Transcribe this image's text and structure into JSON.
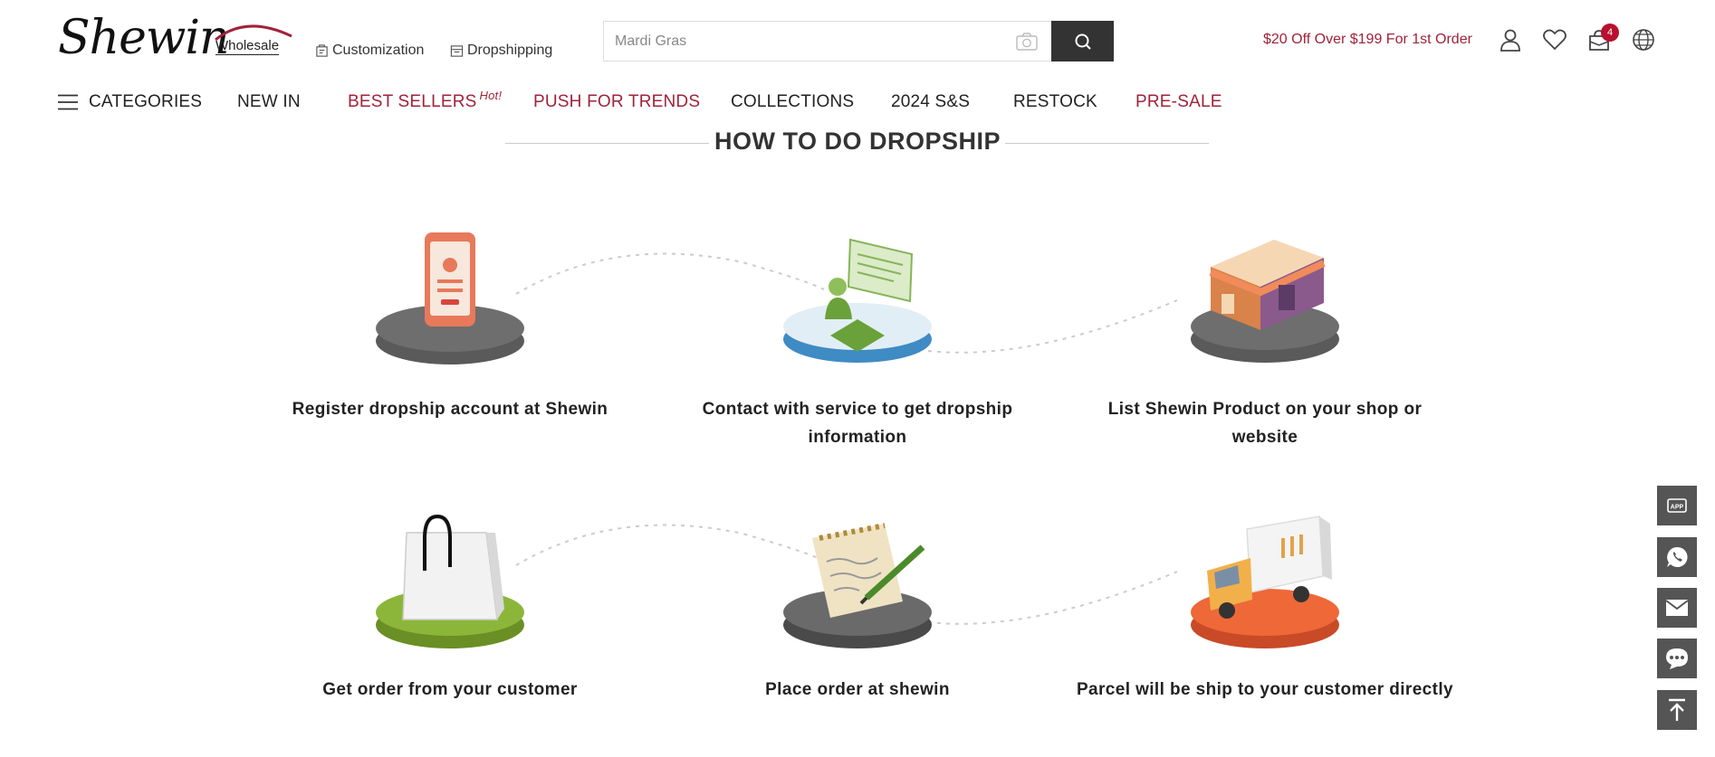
{
  "header": {
    "logo": {
      "brand": "Shewin",
      "sub": "Wholesale"
    },
    "links": {
      "customization": "Customization",
      "dropshipping": "Dropshipping"
    },
    "search": {
      "value": "Mardi Gras"
    },
    "promo": "$20 Off Over $199 For 1st Order",
    "cart_count": "4",
    "accent_color": "#a0233a"
  },
  "nav": {
    "categories": "CATEGORIES",
    "new_in": "NEW IN",
    "best_sellers": "BEST SELLERS",
    "hot_tag": "Hot!",
    "push_for_trends": "PUSH FOR TRENDS",
    "collections": "COLLECTIONS",
    "ss2024": "2024 S&S",
    "restock": "RESTOCK",
    "pre_sale": "PRE-SALE"
  },
  "section": {
    "title": "HOW TO DO DROPSHIP",
    "steps": [
      {
        "label": "Register dropship account at Shewin",
        "icon": "phone-register-icon"
      },
      {
        "label": "Contact with service to get dropship information",
        "icon": "customer-service-icon"
      },
      {
        "label": "List Shewin Product on your shop or website",
        "icon": "shop-store-icon"
      },
      {
        "label": "Get order from your customer",
        "icon": "shopping-bag-icon"
      },
      {
        "label": "Place order at shewin",
        "icon": "notepad-order-icon"
      },
      {
        "label": "Parcel will be ship to your customer directly",
        "icon": "delivery-truck-icon"
      }
    ]
  },
  "side_buttons": [
    "app-icon",
    "whatsapp-icon",
    "email-icon",
    "chat-icon",
    "back-to-top-icon"
  ]
}
